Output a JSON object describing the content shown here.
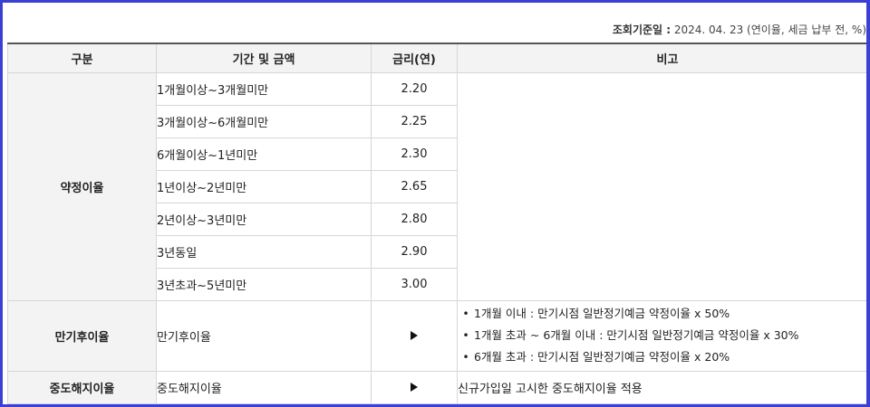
{
  "basis": {
    "label": "조회기준일 :",
    "text": "2024. 04. 23 (연이율, 세금 납부 전, %)"
  },
  "headers": {
    "category": "구분",
    "period": "기간 및 금액",
    "rate": "금리(연)",
    "note": "비고"
  },
  "contract": {
    "category": "약정이율",
    "rows": [
      {
        "period": "1개월이상~3개월미만",
        "rate": "2.20"
      },
      {
        "period": "3개월이상~6개월미만",
        "rate": "2.25"
      },
      {
        "period": "6개월이상~1년미만",
        "rate": "2.30"
      },
      {
        "period": "1년이상~2년미만",
        "rate": "2.65"
      },
      {
        "period": "2년이상~3년미만",
        "rate": "2.80"
      },
      {
        "period": "3년동일",
        "rate": "2.90"
      },
      {
        "period": "3년초과~5년미만",
        "rate": "3.00"
      }
    ]
  },
  "maturity": {
    "category": "만기후이율",
    "period": "만기후이율",
    "notes": [
      "1개월 이내 : 만기시점 일반정기예금 약정이율 x 50%",
      "1개월 초과 ~ 6개월 이내 : 만기시점 일반정기예금 약정이율 x 30%",
      "6개월 초과 : 만기시점 일반정기예금 약정이율 x 20%"
    ],
    "bullet": "•",
    "arrow_icon": "play-triangle-icon"
  },
  "early": {
    "category": "중도해지이율",
    "period": "중도해지이율",
    "note": "신규가입일 고시한 중도해지이율 적용",
    "arrow_icon": "play-triangle-icon"
  },
  "colors": {
    "frame_border": "#3a3fd6",
    "header_bg": "#f3f3f3",
    "grid": "#d6d6d6"
  }
}
